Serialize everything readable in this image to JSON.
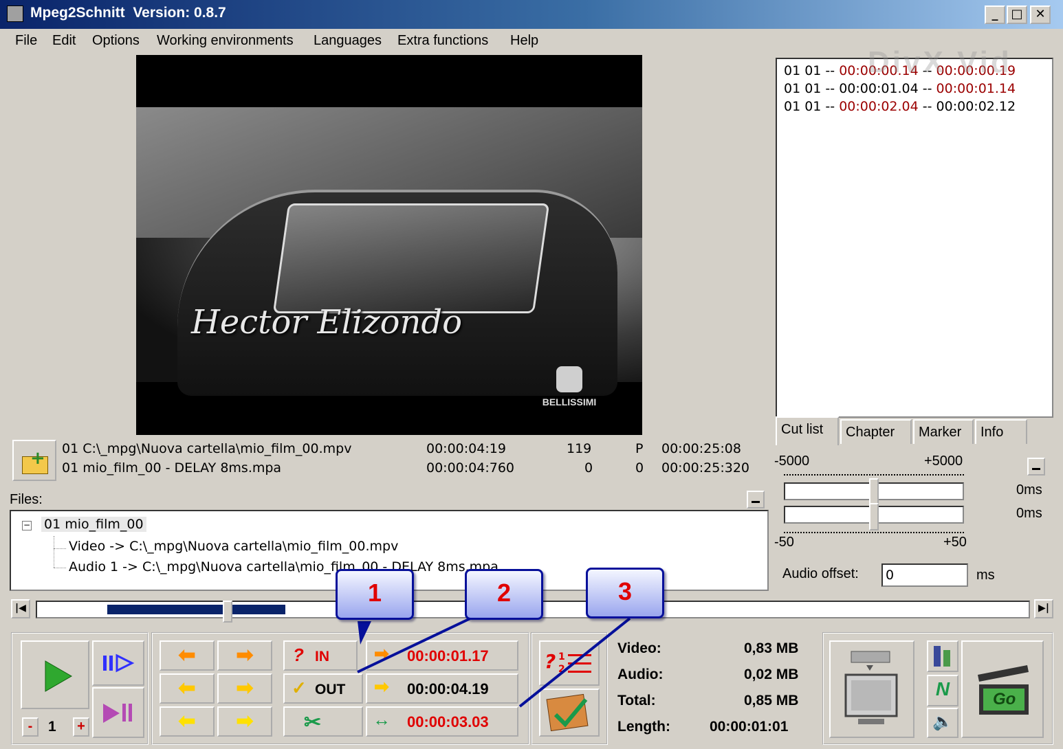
{
  "window": {
    "title": "Mpeg2Schnitt  Version: 0.8.7",
    "controls": [
      "_",
      "□",
      "✕"
    ]
  },
  "menu": [
    "File",
    "Edit",
    "Options",
    "Working environments",
    "Languages",
    "Extra functions",
    "Help"
  ],
  "watermark": "DivX Vid",
  "video": {
    "signature": "Hector Elizondo",
    "channel_logo": "BELLISSIMI"
  },
  "cutlist": {
    "rows": [
      {
        "prefix": "01 01 -- ",
        "start": "00:00:00.14",
        "sep": " -- ",
        "end": "00:00:00.19",
        "start_red": true,
        "end_red": true
      },
      {
        "prefix": "01 01 -- ",
        "start": "00:00:01.04",
        "sep": " -- ",
        "end": "00:00:01.14",
        "start_red": false,
        "end_red": true
      },
      {
        "prefix": "01 01 -- ",
        "start": "00:00:02.04",
        "sep": " -- ",
        "end": "00:00:02.12",
        "start_red": true,
        "end_red": false
      }
    ]
  },
  "tabs": [
    "Cut list",
    "Chapter",
    "Marker",
    "Info"
  ],
  "fileinfo": {
    "video": {
      "name": "01 C:\\_mpg\\Nuova cartella\\mio_film_00.mpv",
      "pos": "00:00:04:19",
      "frames": "119",
      "type": "P",
      "total": "00:00:25:08"
    },
    "audio": {
      "name": "01 mio_film_00 - DELAY 8ms.mpa",
      "pos": "00:00:04:760",
      "frames": "0",
      "type": "0",
      "total": "00:00:25:320"
    }
  },
  "files": {
    "label": "Files:",
    "root": "01 mio_film_00",
    "children": [
      "Video -> C:\\_mpg\\Nuova cartella\\mio_film_00.mpv",
      "Audio 1 -> C:\\_mpg\\Nuova cartella\\mio_film_00 - DELAY 8ms.mpa"
    ]
  },
  "audio_sync": {
    "top_min": "-5000",
    "top_max": "+5000",
    "bottom_min": "-50",
    "bottom_max": "+50",
    "ms1": "0ms",
    "ms2": "0ms",
    "offset_label": "Audio offset:",
    "offset_value": "0",
    "offset_unit": "ms"
  },
  "position": {
    "fraction": 0.18
  },
  "player": {
    "step": "1",
    "minus": "-",
    "plus": "+"
  },
  "marks": {
    "in_label": "IN",
    "out_label": "OUT",
    "in_time": "00:00:01.17",
    "out_time": "00:00:04.19",
    "dur_time": "00:00:03.03"
  },
  "stats": {
    "video_label": "Video:",
    "video_val": "0,83 MB",
    "audio_label": "Audio:",
    "audio_val": "0,02 MB",
    "total_label": "Total:",
    "total_val": "0,85 MB",
    "length_label": "Length:",
    "length_val": "00:00:01:01"
  },
  "go_label": "Go",
  "callouts": [
    "1",
    "2",
    "3"
  ],
  "colors": {
    "title_start": "#0a246a",
    "red_time": "#e00000",
    "dark_red": "#9b0000",
    "arrow_orange": "#ff8c00",
    "arrow_yellow": "#ffd000"
  }
}
